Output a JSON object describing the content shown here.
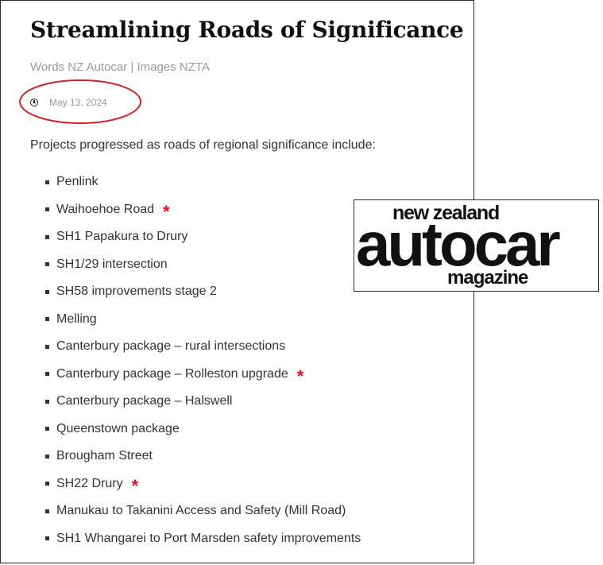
{
  "article": {
    "title": "Streamlining Roads of Significance",
    "byline": "Words NZ Autocar | Images NZTA",
    "date": "May 13, 2024",
    "date_icon": "clock-icon",
    "intro": "Projects progressed as roads of regional significance include:",
    "items": [
      {
        "label": "Penlink",
        "starred": false
      },
      {
        "label": "Waihoehoe Road",
        "starred": true
      },
      {
        "label": "SH1 Papakura to Drury",
        "starred": false
      },
      {
        "label": "SH1/29 intersection",
        "starred": false
      },
      {
        "label": "SH58 improvements stage 2",
        "starred": false
      },
      {
        "label": "Melling",
        "starred": false
      },
      {
        "label": "Canterbury package – rural intersections",
        "starred": false
      },
      {
        "label": "Canterbury package – Rolleston upgrade",
        "starred": true
      },
      {
        "label": "Canterbury package – Halswell",
        "starred": false
      },
      {
        "label": "Queenstown package",
        "starred": false
      },
      {
        "label": "Brougham Street",
        "starred": false
      },
      {
        "label": "SH22 Drury",
        "starred": true
      },
      {
        "label": "Manukau to Takanini Access and Safety (Mill Road)",
        "starred": false
      },
      {
        "label": "SH1 Whangarei to Port Marsden safety improvements",
        "starred": false
      }
    ],
    "star_symbol": "*",
    "star_color": "#e8102a",
    "annotation_color": "#d0202a"
  },
  "logo": {
    "top": "new zealand",
    "main": "autocar",
    "bottom": "magazine"
  }
}
